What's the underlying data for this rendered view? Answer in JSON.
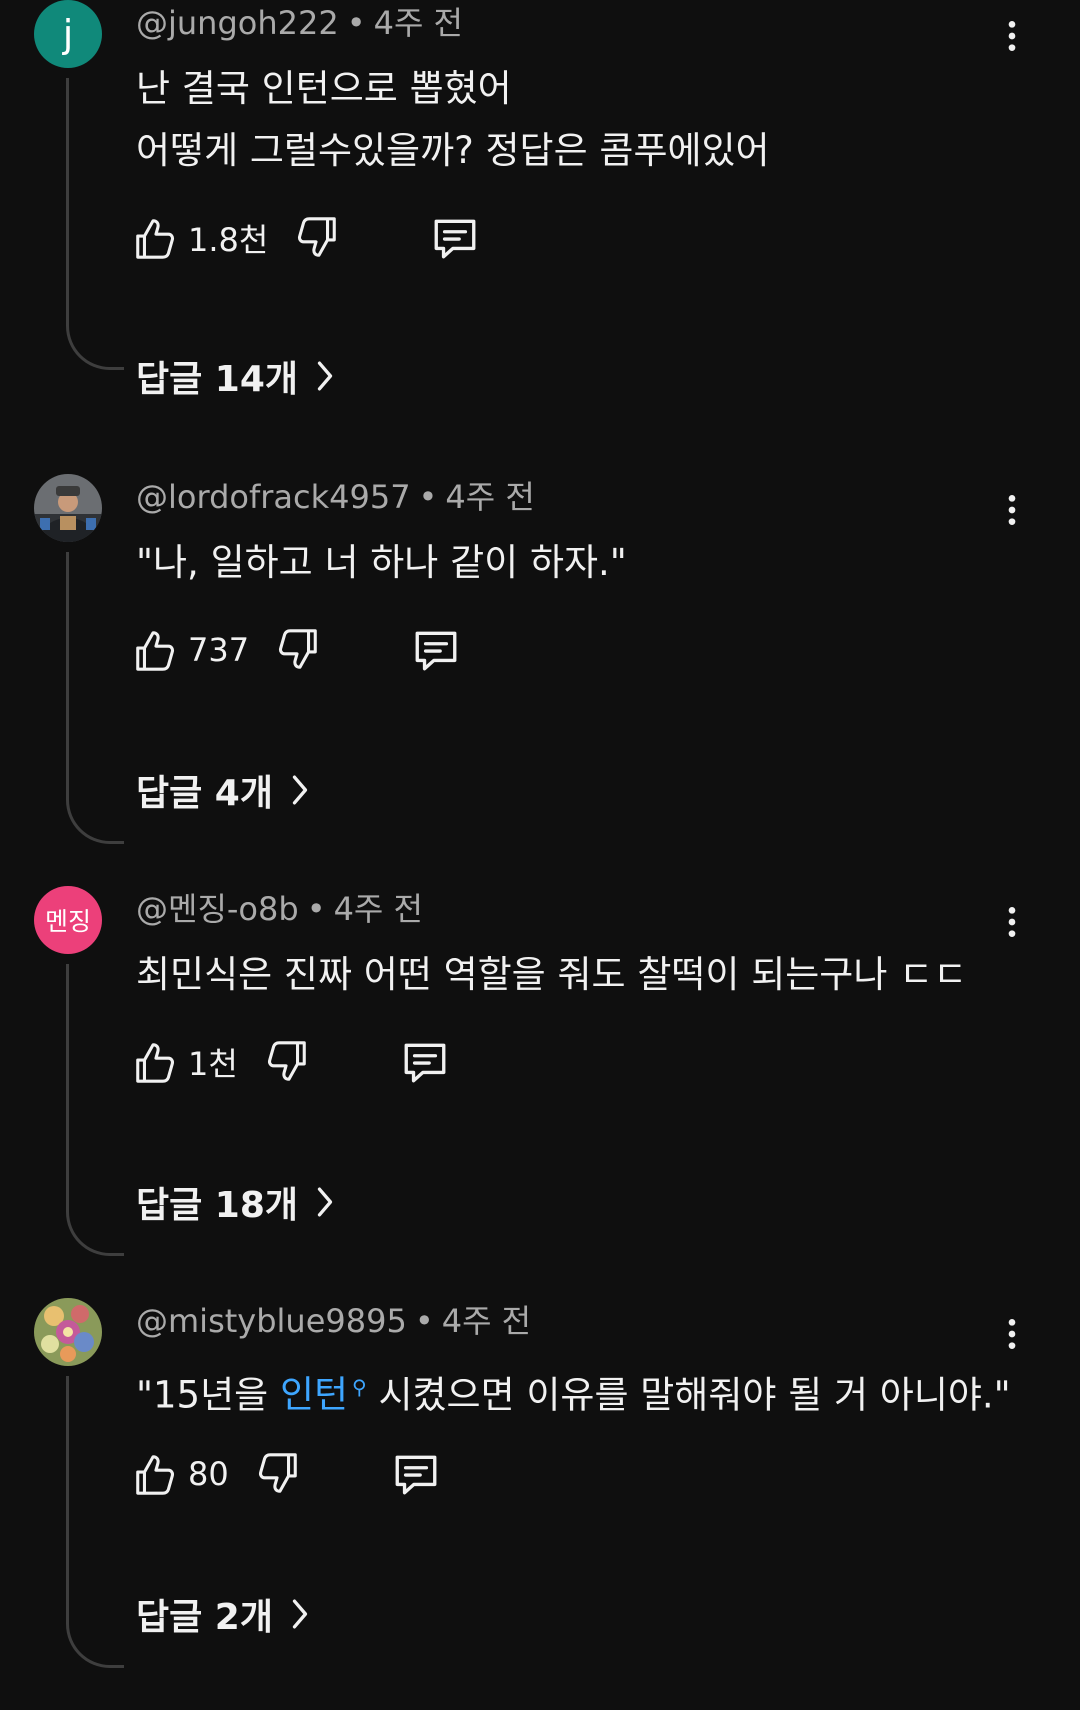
{
  "comments": [
    {
      "author": "@jungoh222",
      "time": "4주 전",
      "avatar_letter": "j",
      "avatar_color": "#10897a",
      "lines": [
        "난 결국 인턴으로 뽑혔어",
        "어떻게 그럴수있을까? 정답은 콤푸에있어"
      ],
      "likes": "1.8천",
      "replies_label": "답글 14개"
    },
    {
      "author": "@lordofrack4957",
      "time": "4주 전",
      "avatar_image": "person-photo",
      "lines": [
        "\"나, 일하고 너 하나 같이 하자.\""
      ],
      "likes": "737",
      "replies_label": "답글 4개"
    },
    {
      "author": "@멘징-o8b",
      "time": "4주 전",
      "avatar_text": "멘징",
      "avatar_color": "#ec407a",
      "lines": [
        "최민식은 진짜 어떤 역할을 줘도 찰떡이 되는구나 ㄷㄷ"
      ],
      "likes": "1천",
      "replies_label": "답글 18개"
    },
    {
      "author": "@mistyblue9895",
      "time": "4주 전",
      "avatar_image": "flower-photo",
      "text_before": "\"15년을 ",
      "link_text": "인턴",
      "link_icon": "search-icon",
      "text_after": " 시켰으면 이유를 말해줘야 될 거 아니야.\"",
      "likes": "80",
      "replies_label": "답글 2개"
    }
  ],
  "colors": {
    "background": "#0f0f0f",
    "text": "#f1f1f1",
    "meta": "#aaaaaa",
    "link": "#3ea6ff",
    "thread_line": "#3e3e3e"
  },
  "icons": {
    "like": "thumbs-up-icon",
    "dislike": "thumbs-down-icon",
    "reply": "comment-icon",
    "more": "more-vertical-icon",
    "chevron": "chevron-right-icon"
  }
}
